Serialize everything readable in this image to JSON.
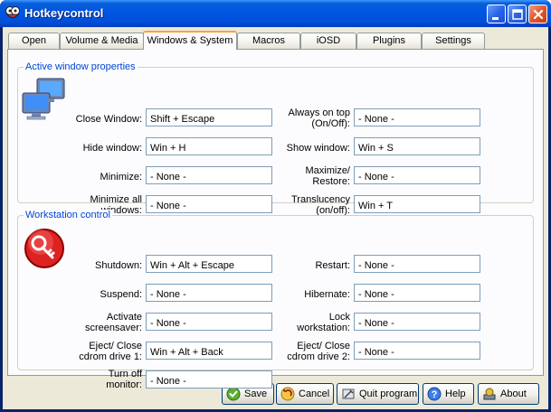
{
  "window": {
    "title": "Hotkeycontrol"
  },
  "tabs": [
    {
      "label": "Open"
    },
    {
      "label": "Volume & Media"
    },
    {
      "label": "Windows & System",
      "active": true
    },
    {
      "label": "Macros"
    },
    {
      "label": "iOSD"
    },
    {
      "label": "Plugins"
    },
    {
      "label": "Settings"
    }
  ],
  "active_window": {
    "legend": "Active window properties",
    "left": [
      {
        "label": "Close Window:",
        "value": "Shift + Escape"
      },
      {
        "label": "Hide window:",
        "value": "Win + H"
      },
      {
        "label": "Minimize:",
        "value": "- None -"
      },
      {
        "label_line1": "Minimize all",
        "label_line2": "windows:",
        "value": "- None -"
      }
    ],
    "right": [
      {
        "label_line1": "Always on top",
        "label_line2": "(On/Off):",
        "value": "- None -"
      },
      {
        "label": "Show window:",
        "value": "Win + S"
      },
      {
        "label_line1": "Maximize/",
        "label_line2": "Restore:",
        "value": "- None -"
      },
      {
        "label_line1": "Translucency",
        "label_line2": "(on/off):",
        "value": "Win + T"
      }
    ]
  },
  "workstation": {
    "legend": "Workstation control",
    "left": [
      {
        "label": "Shutdown:",
        "value": "Win + Alt + Escape"
      },
      {
        "label": "Suspend:",
        "value": "- None -"
      },
      {
        "label_line1": "Activate",
        "label_line2": "screensaver:",
        "value": "- None -"
      },
      {
        "label_line1": "Eject/ Close",
        "label_line2": "cdrom drive 1:",
        "value": "Win + Alt + Back"
      },
      {
        "label_line1": "Turn off",
        "label_line2": "monitor:",
        "value": "- None -"
      }
    ],
    "right": [
      {
        "label": "Restart:",
        "value": "- None -"
      },
      {
        "label": "Hibernate:",
        "value": "- None -"
      },
      {
        "label_line1": "Lock",
        "label_line2": "workstation:",
        "value": "- None -"
      },
      {
        "label_line1": "Eject/ Close",
        "label_line2": "cdrom drive 2:",
        "value": "- None -"
      }
    ]
  },
  "buttons": {
    "save": "Save",
    "cancel": "Cancel",
    "quit": "Quit program",
    "help": "Help",
    "about": "About"
  },
  "colors": {
    "titlebar": "#0054e3",
    "group_legend": "#0046d5",
    "tab_highlight": "#f5a634",
    "dialog_bg": "#ece9d8"
  }
}
